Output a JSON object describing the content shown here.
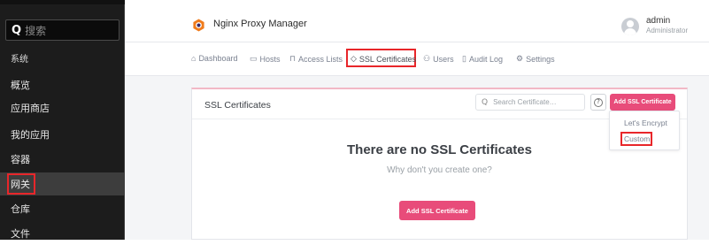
{
  "sidebar": {
    "search_placeholder": "搜索",
    "section_label": "系统",
    "items": [
      {
        "label": "概览"
      },
      {
        "label": "应用商店"
      },
      {
        "label": "我的应用"
      },
      {
        "label": "容器"
      },
      {
        "label": "网关"
      },
      {
        "label": "仓库"
      },
      {
        "label": "文件"
      }
    ],
    "active_index": 4
  },
  "header": {
    "app_title": "Nginx Proxy Manager",
    "user_name": "admin",
    "user_role": "Administrator"
  },
  "nav": {
    "items": [
      {
        "label": "Dashboard",
        "icon": "home-icon"
      },
      {
        "label": "Hosts",
        "icon": "monitor-icon"
      },
      {
        "label": "Access Lists",
        "icon": "lock-icon"
      },
      {
        "label": "SSL Certificates",
        "icon": "shield-icon"
      },
      {
        "label": "Users",
        "icon": "users-icon"
      },
      {
        "label": "Audit Log",
        "icon": "book-icon"
      },
      {
        "label": "Settings",
        "icon": "gear-icon"
      }
    ],
    "active": "SSL Certificates"
  },
  "card": {
    "title": "SSL Certificates",
    "search_placeholder": "Search Certificate…",
    "add_button": "Add SSL Certificate",
    "empty_title": "There are no SSL Certificates",
    "empty_subtitle": "Why don't you create one?",
    "add_button_center": "Add SSL Certificate"
  },
  "dropdown": {
    "items": [
      {
        "label": "Let's Encrypt"
      },
      {
        "label": "Custom"
      }
    ],
    "highlighted": "Custom"
  },
  "colors": {
    "accent": "#e84c7a",
    "highlight_border": "#e8262a",
    "sidebar_bg": "#1c1c1c",
    "logo_orange": "#f07c1c"
  }
}
